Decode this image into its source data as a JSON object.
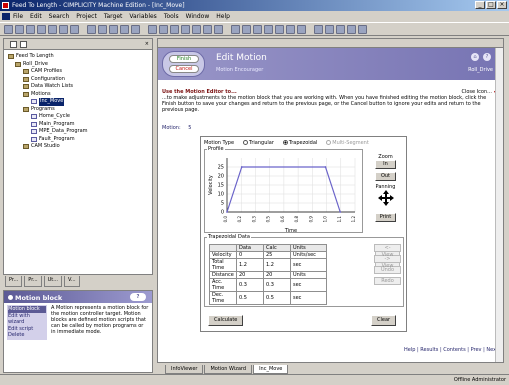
{
  "window": {
    "title": "Feed To Length - CIMPLICITY Machine Edition - [Inc_Move]"
  },
  "menu": [
    "File",
    "Edit",
    "Search",
    "Project",
    "Target",
    "Variables",
    "Tools",
    "Window",
    "Help"
  ],
  "tree": [
    {
      "label": "Feed To Length",
      "level": 0
    },
    {
      "label": "Roll_Drive",
      "level": 1
    },
    {
      "label": "CAM Profiles",
      "level": 2
    },
    {
      "label": "Configuration",
      "level": 2
    },
    {
      "label": "Data Watch Lists",
      "level": 2
    },
    {
      "label": "Motions",
      "level": 2
    },
    {
      "label": "Inc_Move",
      "level": 3,
      "selected": true
    },
    {
      "label": "Programs",
      "level": 2
    },
    {
      "label": "Home_Cycle",
      "level": 3
    },
    {
      "label": "Main_Program",
      "level": 3
    },
    {
      "label": "MPE_Data_Program",
      "level": 3
    },
    {
      "label": "Fault_Program",
      "level": 3
    },
    {
      "label": "CAM Studio",
      "level": 2
    }
  ],
  "left_tabs": [
    "Pr...",
    "Pr...",
    "Ut...",
    "V..."
  ],
  "help": {
    "title": "Motion block",
    "links": [
      "Motion block",
      "Edit with wizard",
      "Edit script",
      "Delete"
    ],
    "text": "A Motion represents a motion block for the motion controller target. Motion blocks are defined motion scripts that can be called by motion programs or in immediate mode."
  },
  "header": {
    "finish": "Finish",
    "cancel": "Cancel",
    "title": "Edit Motion",
    "subtitle": "Motion Encourager",
    "user": "Roll_Drive"
  },
  "instructions": {
    "heading": "Use the Motion Editor to...",
    "text": "...to make adjustments to the motion block that you are working with. When you have finished editing the motion block, click the Finish button to save your changes and return to the previous page, or the Cancel button to ignore your edits and return to the previous page.",
    "close": "Close Icon..."
  },
  "motion_label": "Motion:",
  "motion_value": "5",
  "editor": {
    "motion_type_label": "Motion Type",
    "types": [
      "Triangular",
      "Trapezoidal",
      "Multi-Segment"
    ],
    "profile_label": "Profile",
    "xlabel": "Time",
    "ylabel": "Velocity",
    "zoom_label": "Zoom",
    "in": "In",
    "out": "Out",
    "panning": "Panning",
    "print": "Print",
    "data_label": "Trapezoidal Data",
    "columns": [
      "",
      "Data",
      "Calc",
      "Units"
    ],
    "rows": [
      [
        "Velocity",
        "0",
        "25",
        "Units/sec"
      ],
      [
        "Total Time",
        "1.2",
        "1.2",
        "sec"
      ],
      [
        "Distance",
        "20",
        "20",
        "Units"
      ],
      [
        "Acc. Time",
        "0.3",
        "0.3",
        "sec"
      ],
      [
        "Dec. Time",
        "0.5",
        "0.5",
        "sec"
      ]
    ],
    "nav": [
      "View",
      "View",
      "Undo",
      "Redo"
    ],
    "calculate": "Calculate",
    "clear": "Clear"
  },
  "chart_data": {
    "type": "line",
    "x": [
      0,
      3,
      20,
      23
    ],
    "y": [
      0,
      25,
      25,
      0
    ],
    "xlabel": "Time",
    "ylabel": "Velocity",
    "yticks": [
      0,
      5,
      10,
      15,
      20,
      25
    ],
    "xticks": [
      "0.0",
      "0.2",
      "0.3",
      "0.5",
      "0.6",
      "0.8",
      "0.9",
      "1.0",
      "1.1",
      "1.2"
    ],
    "ylim": [
      0,
      30
    ]
  },
  "footer_links": "Help | Results | Contents | Prev | Next",
  "doc_tabs": [
    "InfoViewer",
    "Motion Wizard",
    "Inc_Move"
  ],
  "status": "Offline  Administrator"
}
